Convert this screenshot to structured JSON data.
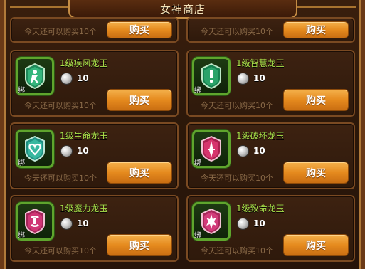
{
  "window": {
    "title": "女神商店"
  },
  "shop": {
    "buy_label": "购买",
    "bind_label": "绑",
    "currency_icon": "silver-coin-icon",
    "items": [
      {
        "name": "",
        "price": "",
        "limit_text": "今天还可以购买10个",
        "partial": true
      },
      {
        "name": "",
        "price": "",
        "limit_text": "今天还可以购买10个",
        "partial": true
      },
      {
        "name": "1级疾风龙玉",
        "price": "10",
        "limit_text": "今天还可以购买10个",
        "icon": "wind-dragon-jade-icon",
        "color": "#3fb27a"
      },
      {
        "name": "1级智慧龙玉",
        "price": "10",
        "limit_text": "今天还可以购买10个",
        "icon": "wisdom-dragon-jade-icon",
        "color": "#2fa86a"
      },
      {
        "name": "1级生命龙玉",
        "price": "10",
        "limit_text": "今天还可以购买10个",
        "icon": "life-dragon-jade-icon",
        "color": "#40b7a0"
      },
      {
        "name": "1级破坏龙玉",
        "price": "10",
        "limit_text": "今天还可以购买10个",
        "icon": "destruction-dragon-jade-icon",
        "color": "#d8306a"
      },
      {
        "name": "1级魔力龙玉",
        "price": "10",
        "limit_text": "今天还可以购买10个",
        "icon": "magic-dragon-jade-icon",
        "color": "#c9306f"
      },
      {
        "name": "1级致命龙玉",
        "price": "10",
        "limit_text": "今天还可以购买10个",
        "icon": "lethal-dragon-jade-icon",
        "color": "#d03a78"
      }
    ]
  }
}
